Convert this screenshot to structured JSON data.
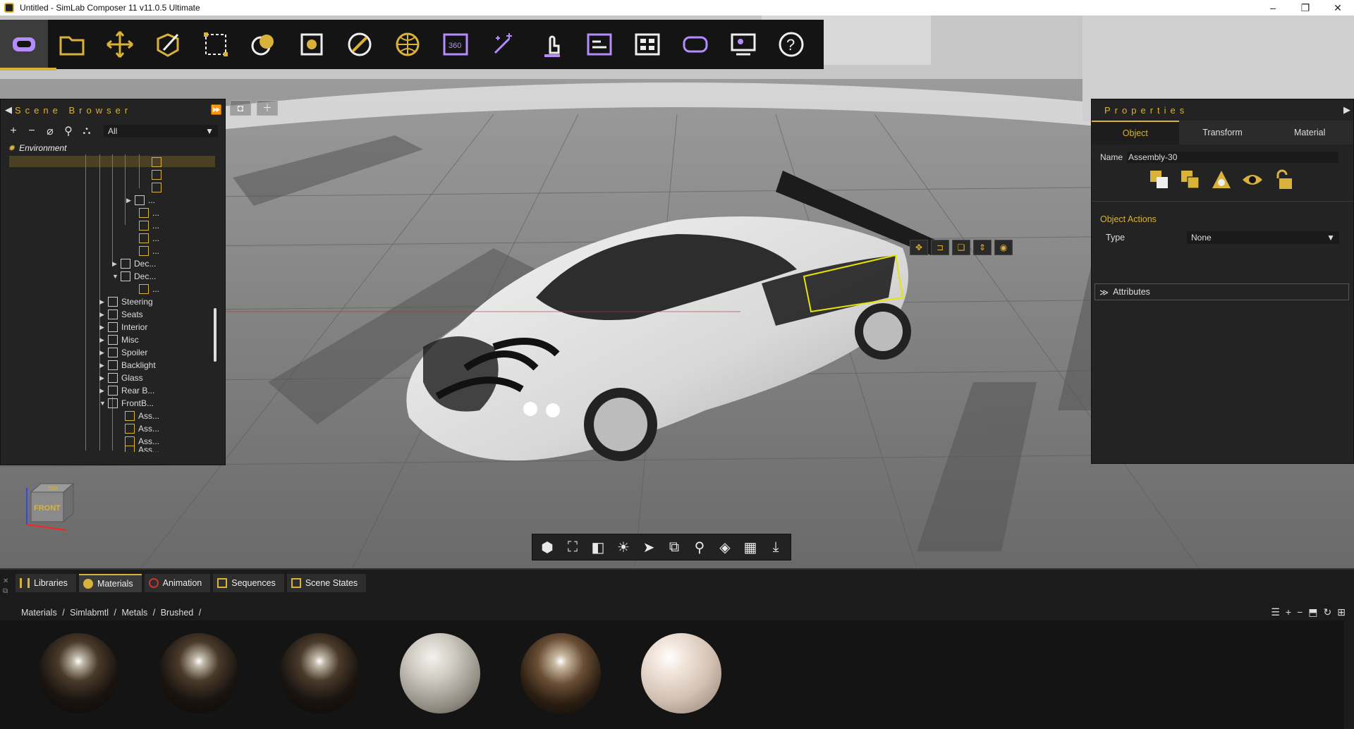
{
  "window": {
    "title": "Untitled - SimLab Composer 11 v11.0.5 Ultimate",
    "controls": [
      "–",
      "❐",
      "✕"
    ]
  },
  "toolbar": {
    "items": [
      "vr-icon",
      "open-icon",
      "move-icon",
      "edit-icon",
      "select-icon",
      "materials-icon",
      "render-icon",
      "disable-icon",
      "globe-icon",
      "360-icon",
      "magic-icon",
      "touch-icon",
      "sequence-icon",
      "layout-icon",
      "vr-headset-icon",
      "presenter-icon",
      "help-icon"
    ]
  },
  "scene_browser": {
    "title": "Scene Browser",
    "filter": "All",
    "environment": "Environment",
    "nodes": [
      "...",
      "...",
      "...",
      "...",
      "...",
      "Dec...",
      "Dec...",
      "...",
      "Steering",
      "Seats",
      "Interior",
      "Misc",
      "Spoiler",
      "Backlight",
      "Glass",
      "Rear B...",
      "FrontB...",
      "Ass...",
      "Ass...",
      "Ass...",
      "Ass..."
    ]
  },
  "properties": {
    "title": "Properties",
    "tabs": [
      "Object",
      "Transform",
      "Material"
    ],
    "name_label": "Name",
    "name_value": "Assembly-30",
    "object_actions": "Object Actions",
    "type_label": "Type",
    "type_value": "None",
    "attributes": "Attributes"
  },
  "nav_cube": {
    "top": "TOP",
    "front": "FRONT"
  },
  "bottom": {
    "tabs": [
      "Libraries",
      "Materials",
      "Animation",
      "Sequences",
      "Scene States"
    ],
    "breadcrumb": [
      "Materials",
      "Simlabmtl",
      "Metals",
      "Brushed"
    ]
  },
  "colors": {
    "accent": "#d9b23a",
    "panel": "#232323",
    "toolbar": "#141414"
  }
}
